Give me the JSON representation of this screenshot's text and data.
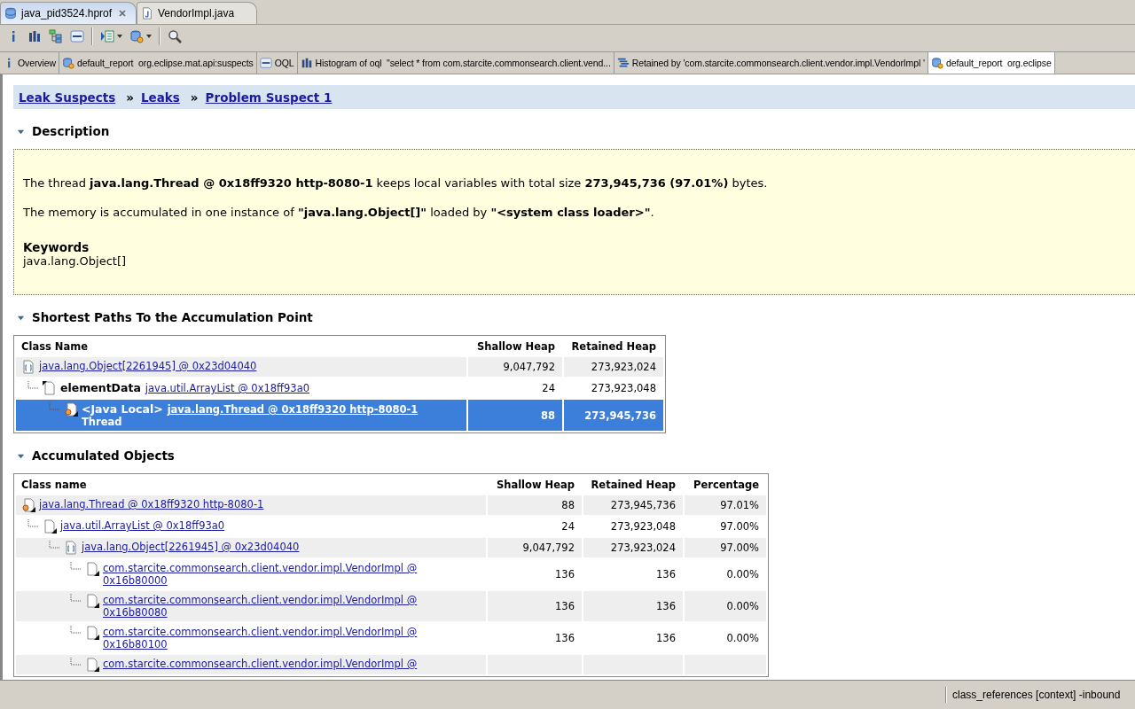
{
  "editor_tabs": [
    {
      "label": "java_pid3524.hprof",
      "kind": "heap",
      "selected": true,
      "closable": true
    },
    {
      "label": "VendorImpl.java",
      "kind": "java",
      "selected": false,
      "closable": false
    }
  ],
  "toolbar": [
    {
      "kind": "info"
    },
    {
      "kind": "histogram"
    },
    {
      "kind": "tree"
    },
    {
      "kind": "oql"
    },
    {
      "kind": "sep"
    },
    {
      "kind": "list",
      "dropdown": true
    },
    {
      "kind": "gears",
      "dropdown": true
    },
    {
      "kind": "sep"
    },
    {
      "kind": "search"
    }
  ],
  "report_tabs": [
    {
      "label": "Overview",
      "kind": "info",
      "selected": false
    },
    {
      "label": "default_report  org.eclipse.mat.api:suspects",
      "kind": "gears",
      "selected": false
    },
    {
      "label": "OQL",
      "kind": "oql",
      "selected": false
    },
    {
      "label": "Histogram of oql  \"select * from com.starcite.commonsearch.client.vend...",
      "kind": "histogram",
      "selected": false
    },
    {
      "label": "Retained by 'com.starcite.commonsearch.client.vendor.impl.VendorImpl '",
      "kind": "list",
      "selected": false
    },
    {
      "label": "default_report  org.eclipse",
      "kind": "gears",
      "selected": true
    }
  ],
  "breadcrumb": [
    "Leak Suspects",
    "Leaks",
    "Problem Suspect 1"
  ],
  "breadcrumb_separator": "»",
  "description": {
    "title": "Description",
    "expanded": true,
    "paragraphs": [
      "The thread **java.lang.Thread @ 0x18ff9320 http-8080-1** keeps local variables with total size **273,945,736 (97.01%)** bytes.",
      "The memory is accumulated in one instance of **\"java.lang.Object[]\"** loaded by **\"<system class loader>\"**."
    ],
    "keywords_label": "Keywords",
    "keywords": "java.lang.Object[]"
  },
  "shortest_paths": {
    "title": "Shortest Paths To the Accumulation Point",
    "expanded": true,
    "columns": [
      "Class Name",
      "Shallow Heap",
      "Retained Heap"
    ],
    "rows": [
      {
        "kind": "array",
        "link": "java.lang.Object[2261945] @ 0x23d04040",
        "shallow": "9,047,792",
        "retained": "273,923,024",
        "selected": false,
        "children": [
          {
            "kind": "object",
            "prefix": "elementData",
            "link": "java.util.ArrayList @ 0x18ff93a0",
            "shallow": "24",
            "retained": "273,923,048",
            "selected": false,
            "children": [
              {
                "kind": "thread",
                "prefix": "<Java Local>",
                "link": "java.lang.Thread @ 0x18ff9320 http-8080-1",
                "suffix": "Thread",
                "shallow": "88",
                "retained": "273,945,736",
                "selected": true
              }
            ]
          }
        ]
      }
    ]
  },
  "accumulated": {
    "title": "Accumulated Objects",
    "expanded": true,
    "columns": [
      "Class name",
      "Shallow Heap",
      "Retained Heap",
      "Percentage"
    ],
    "rows": [
      {
        "kind": "thread",
        "link": "java.lang.Thread @ 0x18ff9320 http-8080-1",
        "shallow": "88",
        "retained": "273,945,736",
        "percentage": "97.01%",
        "children": [
          {
            "kind": "object",
            "link": "java.util.ArrayList @ 0x18ff93a0",
            "shallow": "24",
            "retained": "273,923,048",
            "percentage": "97.00%",
            "children": [
              {
                "kind": "array",
                "link": "java.lang.Object[2261945] @ 0x23d04040",
                "shallow": "9,047,792",
                "retained": "273,923,024",
                "percentage": "97.00%",
                "children": [
                  {
                    "kind": "object",
                    "link": "com.starcite.commonsearch.client.vendor.impl.VendorImpl @ 0x16b80000",
                    "shallow": "136",
                    "retained": "136",
                    "percentage": "0.00%"
                  },
                  {
                    "kind": "object",
                    "link": "com.starcite.commonsearch.client.vendor.impl.VendorImpl @ 0x16b80080",
                    "shallow": "136",
                    "retained": "136",
                    "percentage": "0.00%"
                  },
                  {
                    "kind": "object",
                    "link": "com.starcite.commonsearch.client.vendor.impl.VendorImpl @ 0x16b80100",
                    "shallow": "136",
                    "retained": "136",
                    "percentage": "0.00%"
                  },
                  {
                    "kind": "object",
                    "link": "com.starcite.commonsearch.client.vendor.impl.VendorImpl @"
                  }
                ]
              }
            ]
          }
        ]
      }
    ]
  },
  "status_bar": "class_references [context] -inbound"
}
